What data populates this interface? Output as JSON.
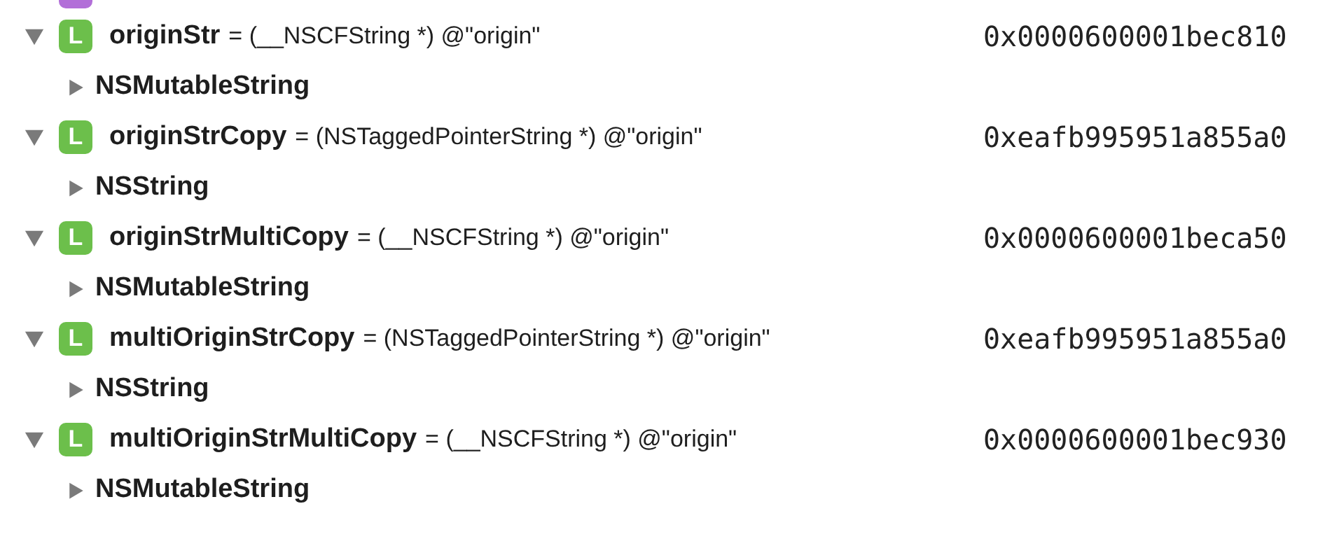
{
  "variables": [
    {
      "name": "originStr",
      "badge": "L",
      "summary": "= (__NSCFString *) @\"origin\"",
      "address": "0x0000600001bec810",
      "expanded": true,
      "children": [
        {
          "name": "NSMutableString",
          "expanded": false
        }
      ]
    },
    {
      "name": "originStrCopy",
      "badge": "L",
      "summary": "= (NSTaggedPointerString *) @\"origin\"",
      "address": "0xeafb995951a855a0",
      "expanded": true,
      "children": [
        {
          "name": "NSString",
          "expanded": false
        }
      ]
    },
    {
      "name": "originStrMultiCopy",
      "badge": "L",
      "summary": "= (__NSCFString *) @\"origin\"",
      "address": "0x0000600001beca50",
      "expanded": true,
      "children": [
        {
          "name": "NSMutableString",
          "expanded": false
        }
      ]
    },
    {
      "name": "multiOriginStrCopy",
      "badge": "L",
      "summary": "= (NSTaggedPointerString *) @\"origin\"",
      "address": "0xeafb995951a855a0",
      "expanded": true,
      "children": [
        {
          "name": "NSString",
          "expanded": false
        }
      ]
    },
    {
      "name": "multiOriginStrMultiCopy",
      "badge": "L",
      "summary": "= (__NSCFString *) @\"origin\"",
      "address": "0x0000600001bec930",
      "expanded": true,
      "children": [
        {
          "name": "NSMutableString",
          "expanded": false
        }
      ]
    }
  ]
}
